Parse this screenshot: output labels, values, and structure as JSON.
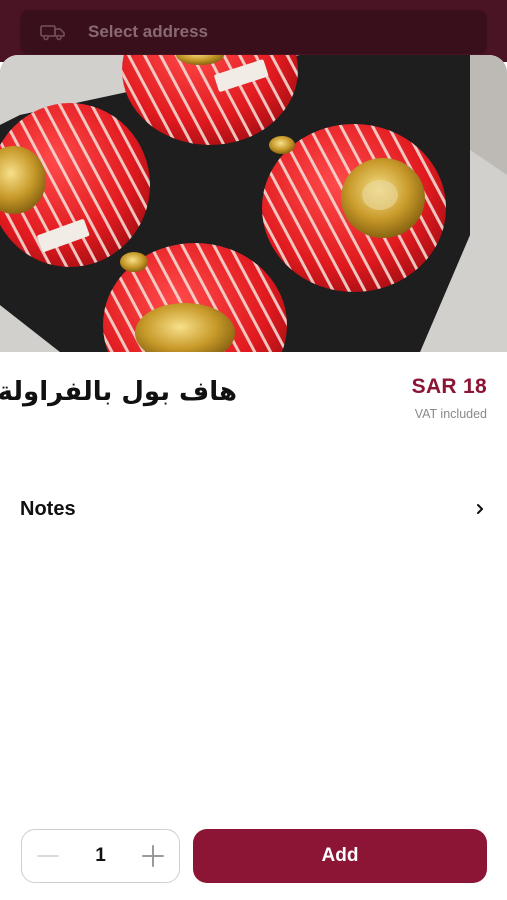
{
  "header": {
    "address_label": "Select address",
    "address_icon": "delivery-truck-icon"
  },
  "product": {
    "image_alt": "cake-photo",
    "title": "هاف بول بالفراولة",
    "price": "SAR 18",
    "vat_note": "VAT included"
  },
  "notes": {
    "label": "Notes",
    "icon": "chevron-right-icon"
  },
  "order": {
    "quantity": "1",
    "decrement_icon": "minus-icon",
    "increment_icon": "plus-icon",
    "add_label": "Add"
  },
  "colors": {
    "brand": "#8c1535",
    "topbar": "#4a1424"
  }
}
